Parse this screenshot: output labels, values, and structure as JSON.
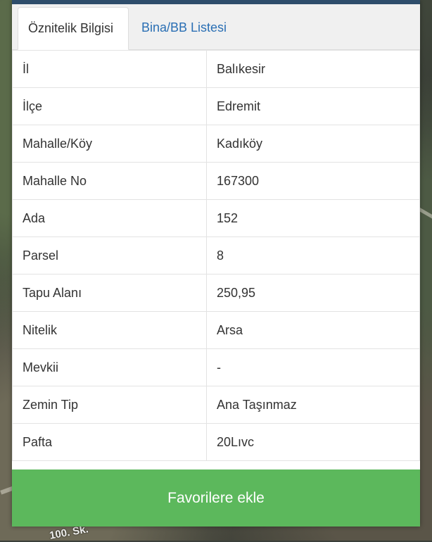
{
  "tabs": [
    {
      "label": "Öznitelik Bilgisi",
      "active": true
    },
    {
      "label": "Bina/BB Listesi",
      "active": false
    }
  ],
  "attributes": [
    {
      "key": "İl",
      "value": "Balıkesir"
    },
    {
      "key": "İlçe",
      "value": "Edremit"
    },
    {
      "key": "Mahalle/Köy",
      "value": "Kadıköy"
    },
    {
      "key": "Mahalle No",
      "value": "167300"
    },
    {
      "key": "Ada",
      "value": "152"
    },
    {
      "key": "Parsel",
      "value": "8"
    },
    {
      "key": "Tapu Alanı",
      "value": "250,95"
    },
    {
      "key": "Nitelik",
      "value": "Arsa"
    },
    {
      "key": "Mevkii",
      "value": "-"
    },
    {
      "key": "Zemin Tip",
      "value": "Ana Taşınmaz"
    },
    {
      "key": "Pafta",
      "value": "20Lıvc"
    }
  ],
  "actions": {
    "favorite_label": "Favorilere ekle"
  },
  "map": {
    "road_label": "100. Sk."
  },
  "colors": {
    "tab_link": "#2a6fb4",
    "button": "#5cb85c",
    "header_bar": "#2e4d6b"
  }
}
